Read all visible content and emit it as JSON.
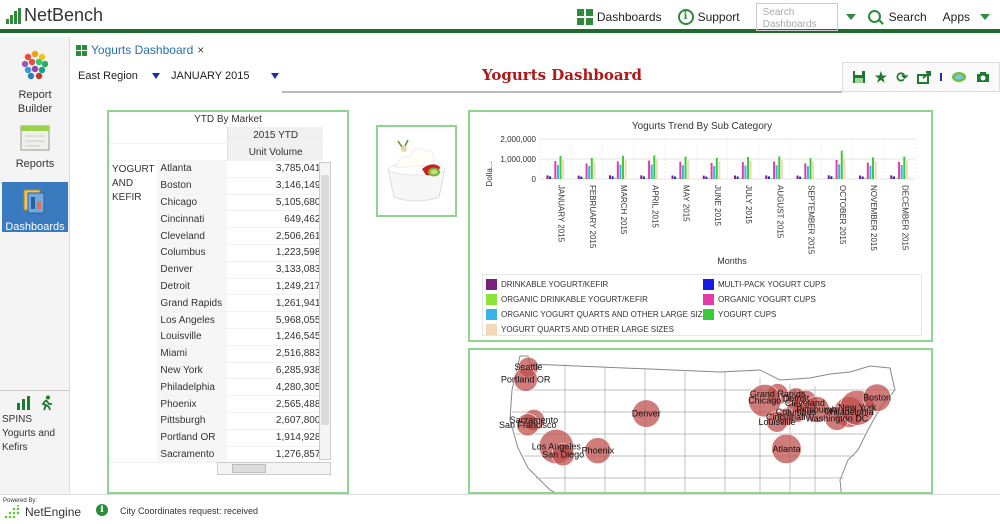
{
  "app": {
    "name": "NetBench"
  },
  "topnav": {
    "dashboards_label": "Dashboards",
    "support_label": "Support",
    "search_placeholder": "Search Dashboards",
    "search_label": "Search",
    "apps_label": "Apps"
  },
  "sidebar": {
    "items": [
      {
        "label": "Report Builder",
        "icon": "report-builder-icon"
      },
      {
        "label": "Reports",
        "icon": "reports-icon"
      },
      {
        "label": "Dashboards",
        "icon": "dashboards-icon",
        "active": true
      }
    ],
    "spins_label": "SPINS Yogurts and Kefirs"
  },
  "tab": {
    "label": "Yogurts Dashboard",
    "close": "×"
  },
  "filters": {
    "region": "East Region",
    "period": "JANUARY 2015"
  },
  "dashboard": {
    "title": "Yogurts Dashboard"
  },
  "ytd": {
    "title": "YTD By Market",
    "col_header": "2015 YTD",
    "sub_header": "Unit Volume",
    "group": "YOGURT AND KEFIR",
    "rows": [
      {
        "market": "Atlanta",
        "value": "3,785,041"
      },
      {
        "market": "Boston",
        "value": "3,146,149"
      },
      {
        "market": "Chicago",
        "value": "5,105,680"
      },
      {
        "market": "Cincinnati",
        "value": "649,462"
      },
      {
        "market": "Cleveland",
        "value": "2,506,261"
      },
      {
        "market": "Columbus",
        "value": "1,223,598"
      },
      {
        "market": "Denver",
        "value": "3,133,083"
      },
      {
        "market": "Detroit",
        "value": "1,249,217"
      },
      {
        "market": "Grand Rapids",
        "value": "1,261,941"
      },
      {
        "market": "Los Angeles",
        "value": "5,968,055"
      },
      {
        "market": "Louisville",
        "value": "1,246,545"
      },
      {
        "market": "Miami",
        "value": "2,516,883"
      },
      {
        "market": "New York",
        "value": "6,285,938"
      },
      {
        "market": "Philadelphia",
        "value": "4,280,305"
      },
      {
        "market": "Phoenix",
        "value": "2,565,488"
      },
      {
        "market": "Pittsburgh",
        "value": "2,607,800"
      },
      {
        "market": "Portland OR",
        "value": "1,914,928"
      },
      {
        "market": "Sacramento",
        "value": "1,276,857"
      }
    ]
  },
  "chart_data": {
    "type": "bar",
    "title": "Yogurts Trend By Sub Category",
    "xlabel": "Months",
    "ylabel": "Dolla...",
    "yticks": [
      "2,000,000",
      "1,000,000",
      "0"
    ],
    "ylim": [
      0,
      2000000
    ],
    "categories": [
      "JANUARY 2015",
      "FEBRUARY 2015",
      "MARCH 2015",
      "APRIL 2015",
      "MAY 2015",
      "JUNE 2015",
      "JULY 2015",
      "AUGUST 2015",
      "SEPTEMBER 2015",
      "OCTOBER 2015",
      "NOVEMBER 2015",
      "DECEMBER 2015"
    ],
    "series": [
      {
        "name": "DRINKABLE YOGURT/KEFIR",
        "color": "#7a1f7a",
        "values": [
          180000,
          170000,
          185000,
          180000,
          175000,
          170000,
          175000,
          180000,
          170000,
          185000,
          175000,
          180000
        ]
      },
      {
        "name": "MULTI-PACK YOGURT CUPS",
        "color": "#1a1ae6",
        "values": [
          130000,
          120000,
          135000,
          130000,
          125000,
          120000,
          125000,
          130000,
          120000,
          135000,
          125000,
          130000
        ]
      },
      {
        "name": "ORGANIC DRINKABLE YOGURT/KEFIR",
        "color": "#8ce63a",
        "values": [
          60000,
          55000,
          65000,
          60000,
          55000,
          55000,
          60000,
          60000,
          55000,
          65000,
          60000,
          60000
        ]
      },
      {
        "name": "ORGANIC YOGURT CUPS",
        "color": "#e63aa8",
        "values": [
          900000,
          780000,
          880000,
          920000,
          860000,
          800000,
          840000,
          870000,
          780000,
          950000,
          820000,
          860000
        ]
      },
      {
        "name": "ORGANIC YOGURT QUARTS AND OTHER LARGE SIZES",
        "color": "#3ab4e6",
        "values": [
          700000,
          650000,
          720000,
          720000,
          690000,
          650000,
          680000,
          690000,
          640000,
          740000,
          660000,
          700000
        ]
      },
      {
        "name": "YOGURT CUPS",
        "color": "#3acb3a",
        "values": [
          1150000,
          1050000,
          1160000,
          1180000,
          1120000,
          1060000,
          1100000,
          1130000,
          1040000,
          1420000,
          1080000,
          1120000
        ]
      },
      {
        "name": "YOGURT QUARTS AND OTHER LARGE SIZES",
        "color": "#f2d9b8",
        "values": [
          950000,
          870000,
          960000,
          980000,
          930000,
          880000,
          910000,
          940000,
          860000,
          1000000,
          890000,
          930000
        ]
      }
    ]
  },
  "map": {
    "cities": [
      {
        "name": "Seattle",
        "lon": -122.3,
        "lat": 47.6,
        "value": 1.0
      },
      {
        "name": "Portland OR",
        "lon": -122.7,
        "lat": 45.5,
        "value": 1.9
      },
      {
        "name": "Sacramento",
        "lon": -121.5,
        "lat": 38.6,
        "value": 1.3
      },
      {
        "name": "San Francisco",
        "lon": -122.4,
        "lat": 37.8,
        "value": 1.5
      },
      {
        "name": "Los Angeles",
        "lon": -118.2,
        "lat": 34.1,
        "value": 6.0
      },
      {
        "name": "San Diego",
        "lon": -117.2,
        "lat": 32.7,
        "value": 1.5
      },
      {
        "name": "Phoenix",
        "lon": -112.1,
        "lat": 33.4,
        "value": 2.6
      },
      {
        "name": "Denver",
        "lon": -104.99,
        "lat": 39.7,
        "value": 3.1
      },
      {
        "name": "Grand Rapids",
        "lon": -85.7,
        "lat": 43.0,
        "value": 1.3
      },
      {
        "name": "Chicago",
        "lon": -87.6,
        "lat": 41.9,
        "value": 5.1
      },
      {
        "name": "Detroit",
        "lon": -83.0,
        "lat": 42.3,
        "value": 1.2
      },
      {
        "name": "Cleveland",
        "lon": -81.7,
        "lat": 41.5,
        "value": 2.5
      },
      {
        "name": "Pittsburgh",
        "lon": -80.0,
        "lat": 40.4,
        "value": 2.6
      },
      {
        "name": "Columbus",
        "lon": -83.0,
        "lat": 39.96,
        "value": 1.2
      },
      {
        "name": "Cincinnati",
        "lon": -84.5,
        "lat": 39.1,
        "value": 0.6
      },
      {
        "name": "Louisville",
        "lon": -85.8,
        "lat": 38.3,
        "value": 1.2
      },
      {
        "name": "Philadelphia",
        "lon": -75.2,
        "lat": 39.95,
        "value": 4.3
      },
      {
        "name": "Washington DC",
        "lon": -77.0,
        "lat": 38.9,
        "value": 2.0
      },
      {
        "name": "New York",
        "lon": -74.0,
        "lat": 40.7,
        "value": 6.3
      },
      {
        "name": "Boston",
        "lon": -71.1,
        "lat": 42.4,
        "value": 3.1
      },
      {
        "name": "Atlanta",
        "lon": -84.4,
        "lat": 33.7,
        "value": 3.8
      }
    ],
    "label_suffix": "Clevel",
    "label_ny": "York",
    "label_sf": "San Francisco"
  },
  "status": {
    "powered_by": "Powered By:",
    "vendor": "NetEngine",
    "message": "City Coordinates request: received"
  }
}
